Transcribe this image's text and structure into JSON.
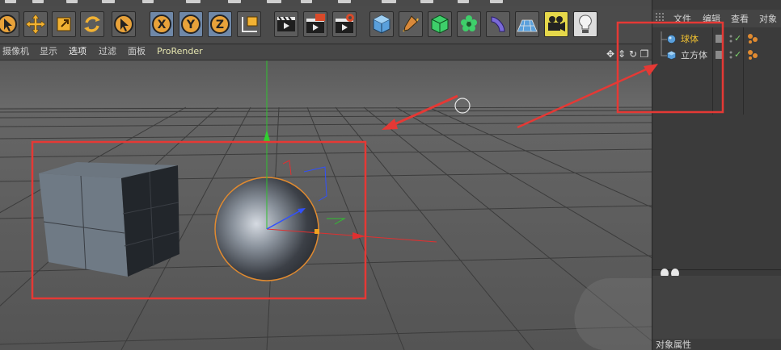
{
  "toolbar": {
    "tools": [
      {
        "id": "select",
        "icon": "live-select-icon"
      },
      {
        "id": "move",
        "icon": "move-icon"
      },
      {
        "id": "scale",
        "icon": "scale-icon"
      },
      {
        "id": "rotate",
        "icon": "rotate-icon"
      },
      {
        "id": "last",
        "icon": "recent-tool-icon"
      },
      {
        "id": "x",
        "label": "X",
        "icon": "x-axis-lock-icon"
      },
      {
        "id": "y",
        "label": "Y",
        "icon": "y-axis-lock-icon"
      },
      {
        "id": "z",
        "label": "Z",
        "icon": "z-axis-lock-icon"
      },
      {
        "id": "coord",
        "icon": "coordinate-system-icon"
      },
      {
        "id": "render-view",
        "icon": "render-view-icon"
      },
      {
        "id": "render-pv",
        "icon": "render-picture-viewer-icon"
      },
      {
        "id": "render-settings",
        "icon": "render-settings-icon"
      },
      {
        "id": "cube",
        "icon": "cube-primitive-icon"
      },
      {
        "id": "pen",
        "icon": "pen-spline-icon"
      },
      {
        "id": "subdiv",
        "icon": "subdivision-surface-icon"
      },
      {
        "id": "array",
        "icon": "cloner-icon"
      },
      {
        "id": "deformer",
        "icon": "bend-deformer-icon"
      },
      {
        "id": "floor",
        "icon": "floor-icon"
      },
      {
        "id": "camera",
        "icon": "camera-icon"
      },
      {
        "id": "light",
        "icon": "light-icon"
      }
    ]
  },
  "viewport_menu": {
    "items": [
      "摄像机",
      "显示",
      "选项",
      "过滤",
      "面板",
      "ProRender"
    ],
    "active_index": 2
  },
  "right_panel": {
    "menu": [
      "文件",
      "编辑",
      "查看",
      "对象"
    ],
    "objects": [
      {
        "name": "球体",
        "icon": "sphere-object-icon",
        "color": "#f0c030",
        "checked": "✓"
      },
      {
        "name": "立方体",
        "icon": "cube-object-icon",
        "color": "#d6d6d6",
        "checked": "✓"
      }
    ],
    "attributes_title": "对象属性"
  },
  "colors": {
    "annotation": "#e53935",
    "x_axis": "#e03030",
    "y_axis": "#30c030",
    "z_axis": "#3050ff",
    "selection_outline": "#e08a30"
  }
}
